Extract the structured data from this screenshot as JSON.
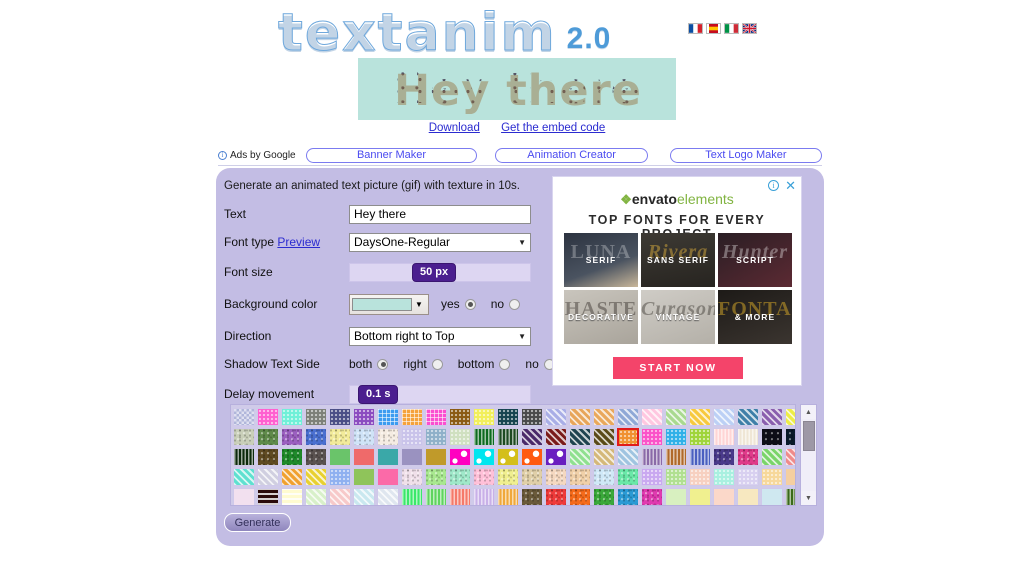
{
  "site": {
    "logo_main": "textanim",
    "logo_version": "2.0"
  },
  "languages": [
    {
      "name": "flag-france",
      "colors": [
        "#0b4ea2",
        "#ffffff",
        "#d4202a"
      ]
    },
    {
      "name": "flag-spain",
      "colors": [
        "#c60b1e",
        "#ffc400",
        "#c60b1e"
      ]
    },
    {
      "name": "flag-italy",
      "colors": [
        "#009246",
        "#ffffff",
        "#ce2b37"
      ]
    },
    {
      "name": "flag-united-kingdom",
      "colors": [
        "#00247d",
        "#ffffff",
        "#cf142b"
      ]
    }
  ],
  "preview": {
    "text": "Hey there",
    "background_color": "#b9e3dc",
    "text_color": "#f58220",
    "download_label": "Download",
    "embed_label": "Get the embed code"
  },
  "ads_bar": {
    "label": "Ads by Google",
    "info_icon": "info-icon",
    "items": [
      {
        "label": "Banner Maker"
      },
      {
        "label": "Animation Creator"
      },
      {
        "label": "Text Logo Maker"
      }
    ]
  },
  "form": {
    "title": "Generate an animated text picture (gif) with texture in 10s.",
    "text": {
      "label": "Text",
      "value": "Hey there",
      "placeholder": ""
    },
    "font_type": {
      "label": "Font type",
      "preview_link": "Preview",
      "value": "DaysOne-Regular"
    },
    "font_size": {
      "label": "Font size",
      "value": "50",
      "unit": "px",
      "display": "50 px"
    },
    "background_color": {
      "label": "Background color",
      "swatch": "#b9e3dc",
      "options": [
        {
          "label": "yes",
          "selected": true
        },
        {
          "label": "no",
          "selected": false
        }
      ]
    },
    "direction": {
      "label": "Direction",
      "value": "Bottom right to Top"
    },
    "shadow_text_side": {
      "label": "Shadow Text Side",
      "options": [
        {
          "label": "both",
          "selected": true
        },
        {
          "label": "right",
          "selected": false
        },
        {
          "label": "bottom",
          "selected": false
        },
        {
          "label": "no",
          "selected": false
        }
      ]
    },
    "delay_movement": {
      "label": "Delay movement",
      "value": "0.1",
      "unit": "s",
      "display": "0.1 s"
    },
    "generate_label": "Generate"
  },
  "envato_ad": {
    "info_icon": "info-icon",
    "close_icon": "close-icon",
    "logo_leaf": "❖",
    "logo_part1": "envato",
    "logo_part2": "elements",
    "headline": "TOP FONTS FOR EVERY PROJECT",
    "tiles": [
      {
        "label": "SERIF",
        "ghost": "LUNA"
      },
      {
        "label": "SANS SERIF",
        "ghost": "Rivera"
      },
      {
        "label": "SCRIPT",
        "ghost": "Hunter"
      },
      {
        "label": "DECORATIVE",
        "ghost": "HASTE"
      },
      {
        "label": "VINTAGE",
        "ghost": "Curason"
      },
      {
        "label": "& MORE",
        "ghost": "FONTAINE"
      }
    ],
    "cta_label": "START NOW"
  },
  "textures": {
    "selected_index": 40,
    "scrollbar": {
      "up_icon": "triangle-up-icon",
      "down_icon": "triangle-down-icon",
      "thumb": "scrollbar-thumb"
    },
    "swatches": [
      {
        "c": "#dfe0f0",
        "p": "check"
      },
      {
        "c": "#ff5fd0",
        "p": "dot"
      },
      {
        "c": "#6ff0d8",
        "p": "dot"
      },
      {
        "c": "#7d8078",
        "p": "dot"
      },
      {
        "c": "#4a4e86",
        "p": "dot"
      },
      {
        "c": "#8b4bc0",
        "p": "dot"
      },
      {
        "c": "#3d9bf0",
        "p": "grid"
      },
      {
        "c": "#f5a23c",
        "p": "grid"
      },
      {
        "c": "#fb4fd0",
        "p": "grid"
      },
      {
        "c": "#8a5a12",
        "p": "dot"
      },
      {
        "c": "#f2ef5a",
        "p": "dot"
      },
      {
        "c": "#16444f",
        "p": "dot"
      },
      {
        "c": "#4a4a4a",
        "p": "dot"
      },
      {
        "c": "#a9aee6",
        "p": "diag"
      },
      {
        "c": "#e7a559",
        "p": "diag"
      },
      {
        "c": "#e9a85c",
        "p": "diag"
      },
      {
        "c": "#8fa8d6",
        "p": "diag"
      },
      {
        "c": "#ffc7e0",
        "p": "diag"
      },
      {
        "c": "#a9d98f",
        "p": "diag"
      },
      {
        "c": "#f7c93d",
        "p": "diag"
      },
      {
        "c": "#bcd0f5",
        "p": "diag"
      },
      {
        "c": "#3f7fa8",
        "p": "diag"
      },
      {
        "c": "#8a5fae",
        "p": "diag"
      },
      {
        "c": "#eded45",
        "p": "diag"
      },
      {
        "c": "#c9cfb9",
        "p": "noise"
      },
      {
        "c": "#5f8a4a",
        "p": "noise"
      },
      {
        "c": "#9b5fc0",
        "p": "noise"
      },
      {
        "c": "#4a6fd0",
        "p": "noise"
      },
      {
        "c": "#f2eb9a",
        "p": "noise"
      },
      {
        "c": "#cfe3f7",
        "p": "noise"
      },
      {
        "c": "#f5ece2",
        "p": "noise"
      },
      {
        "c": "#c9c3ea",
        "p": "dot"
      },
      {
        "c": "#8fb0c9",
        "p": "dot"
      },
      {
        "c": "#cfe0c0",
        "p": "dot"
      },
      {
        "c": "#0d6b20",
        "p": "vstripe"
      },
      {
        "c": "#1d4a22",
        "p": "vstripe"
      },
      {
        "c": "#4a2a6a",
        "p": "diag"
      },
      {
        "c": "#7a1a1a",
        "p": "diag"
      },
      {
        "c": "#1f4450",
        "p": "diag"
      },
      {
        "c": "#5a4a1a",
        "p": "diag"
      },
      {
        "c": "#f09030",
        "p": "dot"
      },
      {
        "c": "#fb52c8",
        "p": "dot"
      },
      {
        "c": "#30b0e8",
        "p": "dot"
      },
      {
        "c": "#9fd43a",
        "p": "dot"
      },
      {
        "c": "#ffd5d5",
        "p": "vstripe"
      },
      {
        "c": "#efe6d5",
        "p": "vstripe"
      },
      {
        "c": "#0e0e18",
        "p": "noise"
      },
      {
        "c": "#0a1a2a",
        "p": "noise"
      },
      {
        "c": "#0c2a0c",
        "p": "vstripe"
      },
      {
        "c": "#5f4a22",
        "p": "noise"
      },
      {
        "c": "#1f8a2a",
        "p": "noise"
      },
      {
        "c": "#5a5250",
        "p": "noise"
      },
      {
        "c": "#6ac46a",
        "p": "solid"
      },
      {
        "c": "#ef6a6a",
        "p": "solid"
      },
      {
        "c": "#3aa8a8",
        "p": "solid"
      },
      {
        "c": "#9a92c0",
        "p": "solid"
      },
      {
        "c": "#c09a2a",
        "p": "solid"
      },
      {
        "c": "#ff00c0",
        "p": "star"
      },
      {
        "c": "#00e6ef",
        "p": "star"
      },
      {
        "c": "#d4bf1a",
        "p": "star"
      },
      {
        "c": "#ff5a10",
        "p": "star"
      },
      {
        "c": "#6a1fc0",
        "p": "star"
      },
      {
        "c": "#8fe08f",
        "p": "diag"
      },
      {
        "c": "#d4b87a",
        "p": "diag"
      },
      {
        "c": "#9fc4e0",
        "p": "diag"
      },
      {
        "c": "#8a6aa8",
        "p": "vstripe"
      },
      {
        "c": "#b06a2a",
        "p": "vstripe"
      },
      {
        "c": "#4a5fc0",
        "p": "vstripe"
      },
      {
        "c": "#4a3a8a",
        "p": "noise"
      },
      {
        "c": "#e03a8a",
        "p": "noise"
      },
      {
        "c": "#7ad46a",
        "p": "diag"
      },
      {
        "c": "#ef8a8a",
        "p": "diag"
      },
      {
        "c": "#5fe0d0",
        "p": "diag"
      },
      {
        "c": "#d0cfe0",
        "p": "diag"
      },
      {
        "c": "#f0a030",
        "p": "diag"
      },
      {
        "c": "#e8d030",
        "p": "diag"
      },
      {
        "c": "#8fb0f0",
        "p": "dot"
      },
      {
        "c": "#8fc45a",
        "p": "solid"
      },
      {
        "c": "#fb6aa8",
        "p": "solid"
      },
      {
        "c": "#f0e0ea",
        "p": "noise"
      },
      {
        "c": "#a8e88f",
        "p": "noise"
      },
      {
        "c": "#9fe8c9",
        "p": "noise"
      },
      {
        "c": "#ffc0d8",
        "p": "noise"
      },
      {
        "c": "#f0ef8f",
        "p": "noise"
      },
      {
        "c": "#e0cfa8",
        "p": "noise"
      },
      {
        "c": "#f5d8c0",
        "p": "noise"
      },
      {
        "c": "#f0d0a8",
        "p": "noise"
      },
      {
        "c": "#cfe8f7",
        "p": "noise"
      },
      {
        "c": "#6ae8a8",
        "p": "noise"
      },
      {
        "c": "#c9a8f0",
        "p": "dot"
      },
      {
        "c": "#b0e090",
        "p": "dot"
      },
      {
        "c": "#f7d0c0",
        "p": "dot"
      },
      {
        "c": "#a8f0e0",
        "p": "dot"
      },
      {
        "c": "#d8d0f0",
        "p": "dot"
      },
      {
        "c": "#f7d89a",
        "p": "dot"
      },
      {
        "c": "#f5cfa0",
        "p": "solid"
      },
      {
        "c": "#f2e0ef",
        "p": "solid"
      },
      {
        "c": "#2a0a0a",
        "p": "hstripe"
      },
      {
        "c": "#fffbd0",
        "p": "hstripe"
      },
      {
        "c": "#d8f0c9",
        "p": "diag"
      },
      {
        "c": "#f7c9c9",
        "p": "diag"
      },
      {
        "c": "#c9e8ef",
        "p": "diag"
      },
      {
        "c": "#dfe6ef",
        "p": "diag"
      },
      {
        "c": "#3ae86a",
        "p": "vstripe"
      },
      {
        "c": "#5fd45f",
        "p": "vstripe"
      },
      {
        "c": "#f57a6a",
        "p": "vstripe"
      },
      {
        "c": "#c9b0e8",
        "p": "vstripe"
      },
      {
        "c": "#f0a83a",
        "p": "vstripe"
      },
      {
        "c": "#6a5a3a",
        "p": "noise"
      },
      {
        "c": "#ef3a3a",
        "p": "noise"
      },
      {
        "c": "#f56a1a",
        "p": "noise"
      },
      {
        "c": "#3aa83a",
        "p": "noise"
      },
      {
        "c": "#2a9ad4",
        "p": "noise"
      },
      {
        "c": "#e03ab0",
        "p": "noise"
      },
      {
        "c": "#d8f0c0",
        "p": "solid"
      },
      {
        "c": "#f0f08f",
        "p": "solid"
      },
      {
        "c": "#fbd8c9",
        "p": "solid"
      },
      {
        "c": "#f7e8c0",
        "p": "solid"
      },
      {
        "c": "#cfe8f0",
        "p": "solid"
      },
      {
        "c": "#3a6a1a",
        "p": "vstripe"
      }
    ]
  }
}
